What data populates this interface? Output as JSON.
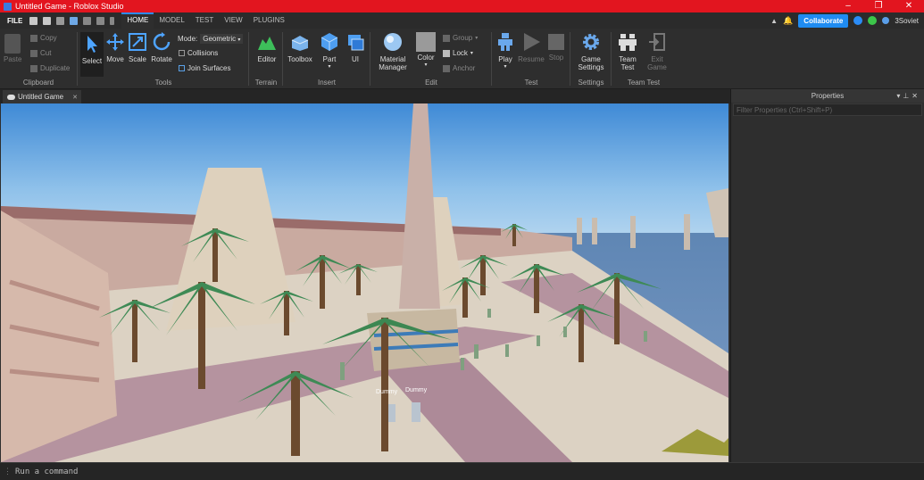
{
  "window": {
    "title": "Untitled Game - Roblox Studio",
    "controls": [
      "–",
      "❐",
      "✕"
    ]
  },
  "menubar": {
    "file": "FILE",
    "tabs": [
      "HOME",
      "MODEL",
      "TEST",
      "VIEW",
      "PLUGINS"
    ],
    "active_tab": "HOME",
    "collaborate": "Collaborate",
    "username": "3Soviet"
  },
  "ribbon": {
    "clipboard": {
      "label": "Clipboard",
      "paste": "Paste",
      "copy": "Copy",
      "cut": "Cut",
      "duplicate": "Duplicate"
    },
    "tools": {
      "label": "Tools",
      "select": "Select",
      "move": "Move",
      "scale": "Scale",
      "rotate": "Rotate",
      "mode_label": "Mode:",
      "mode_value": "Geometric",
      "collisions": "Collisions",
      "join_surfaces": "Join Surfaces"
    },
    "terrain": {
      "label": "Terrain",
      "editor": "Editor"
    },
    "insert": {
      "label": "Insert",
      "toolbox": "Toolbox",
      "part": "Part",
      "ui": "UI"
    },
    "edit": {
      "label": "Edit",
      "material_manager_1": "Material",
      "material_manager_2": "Manager",
      "color": "Color",
      "group": "Group",
      "lock": "Lock",
      "anchor": "Anchor"
    },
    "test": {
      "label": "Test",
      "play": "Play",
      "resume": "Resume",
      "stop": "Stop"
    },
    "settings": {
      "label": "Settings",
      "game_settings_1": "Game",
      "game_settings_2": "Settings"
    },
    "team_test": {
      "label": "Team Test",
      "team_test_1": "Team",
      "team_test_2": "Test",
      "exit_game_1": "Exit",
      "exit_game_2": "Game"
    }
  },
  "document_tab": {
    "title": "Untitled Game",
    "close": "✕"
  },
  "viewport": {
    "npc_labels": [
      "Dummy",
      "Dummy"
    ]
  },
  "properties": {
    "title": "Properties",
    "filter_placeholder": "Filter Properties (Ctrl+Shift+P)"
  },
  "command_bar": {
    "placeholder": "Run a command"
  },
  "colors": {
    "titlebar": "#e2151f",
    "accent": "#1f8cf2",
    "sky": "#6aa9df",
    "sand": "#dcd2c3",
    "palm": "#3e8a55"
  }
}
